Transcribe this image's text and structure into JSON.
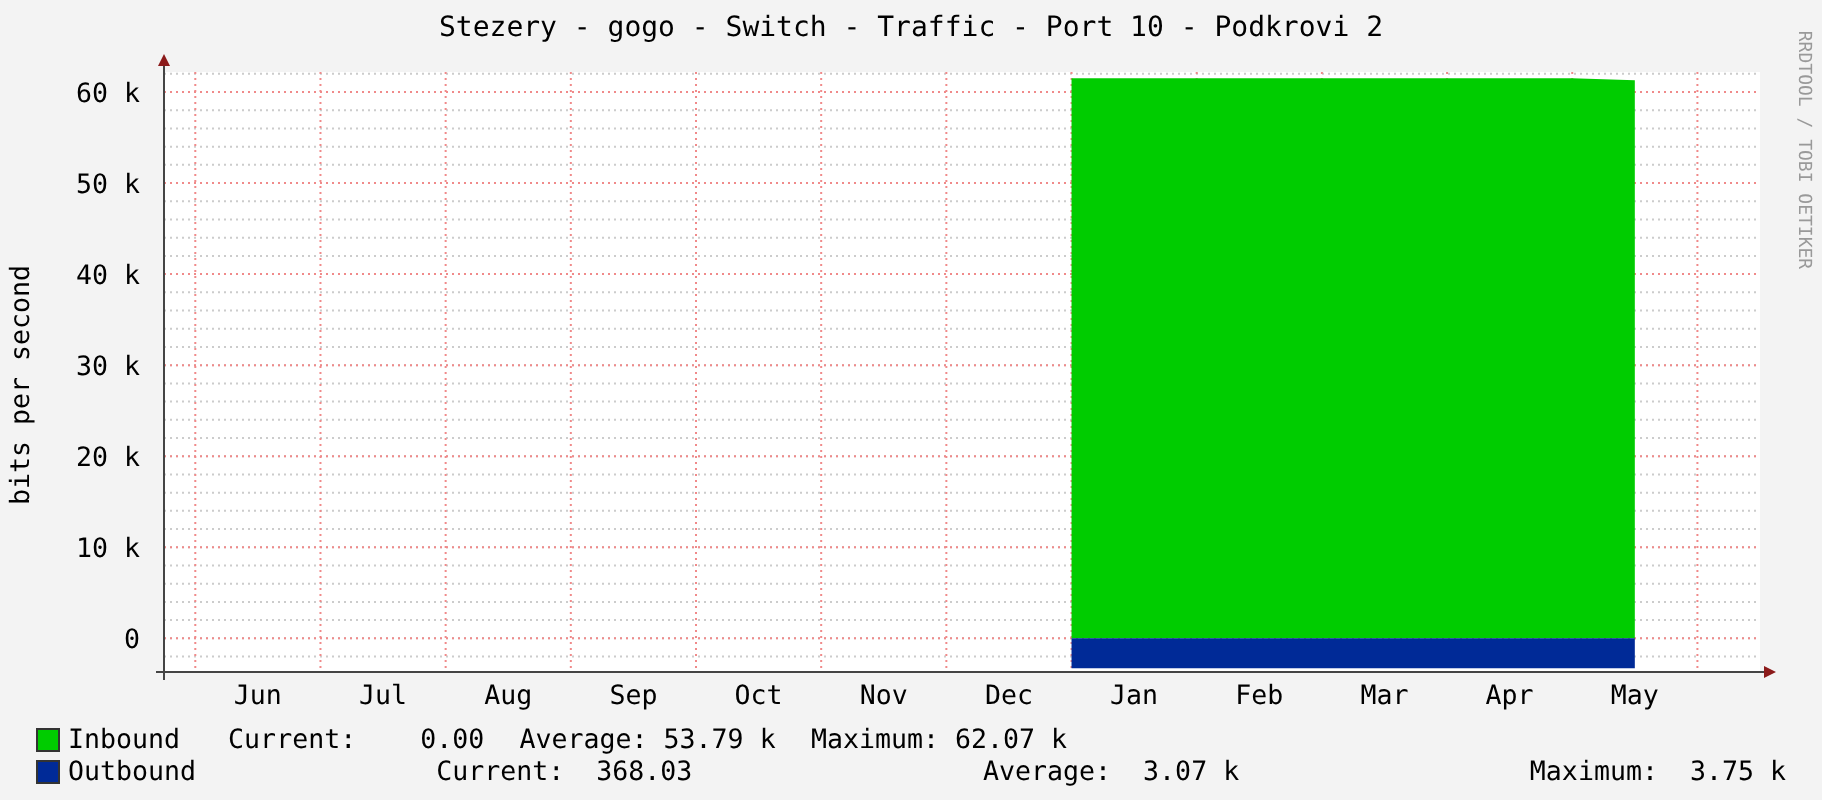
{
  "chart_data": {
    "type": "area",
    "title": "Stezery - gogo - Switch - Traffic - Port 10 - Podkrovi 2",
    "ylabel": "bits per second",
    "grid": true,
    "categories": [
      null,
      "Jun",
      null,
      "Jul",
      null,
      "Aug",
      null,
      "Sep",
      null,
      "Oct",
      null,
      "Nov",
      null,
      "Dec",
      null,
      "Jan",
      null,
      "Feb",
      null,
      "Mar",
      null,
      "Apr",
      null,
      "May",
      null
    ],
    "series": [
      {
        "name": "Inbound",
        "color": "#00cc00",
        "values": [
          null,
          null,
          null,
          null,
          null,
          null,
          null,
          null,
          null,
          null,
          null,
          null,
          null,
          null,
          61500,
          61500,
          61500,
          61500,
          61500,
          61500,
          61500,
          61500,
          61500,
          61300,
          null
        ]
      },
      {
        "name": "Outbound",
        "color": "#002a97",
        "values": [
          null,
          null,
          null,
          null,
          null,
          null,
          null,
          null,
          null,
          null,
          null,
          null,
          null,
          null,
          -3300,
          -3300,
          -3300,
          -3300,
          -3300,
          -3300,
          -3300,
          -3300,
          -3300,
          -3300,
          null
        ]
      }
    ],
    "ylim": [
      -3700,
      62200
    ],
    "yticks": [
      {
        "value": 0,
        "label": "0"
      },
      {
        "value": 10000,
        "label": "10 k"
      },
      {
        "value": 20000,
        "label": "20 k"
      },
      {
        "value": 30000,
        "label": "30 k"
      },
      {
        "value": 40000,
        "label": "40 k"
      },
      {
        "value": 50000,
        "label": "50 k"
      },
      {
        "value": 60000,
        "label": "60 k"
      }
    ]
  },
  "credit": "RRDTOOL / TOBI OETIKER",
  "legend": [
    {
      "kind": "compact",
      "stats": [
        {
          "label": "Current:",
          "value": "0.00"
        },
        {
          "label": "Average:",
          "value": "53.79 k"
        },
        {
          "label": "Maximum:",
          "value": "62.07 k"
        }
      ]
    },
    {
      "kind": "spread",
      "stats": [
        {
          "label": "Current:",
          "value": "368.03"
        },
        {
          "label": "Average:",
          "value": "3.07 k"
        },
        {
          "label": "Maximum:",
          "value": "3.75 k"
        }
      ]
    }
  ]
}
